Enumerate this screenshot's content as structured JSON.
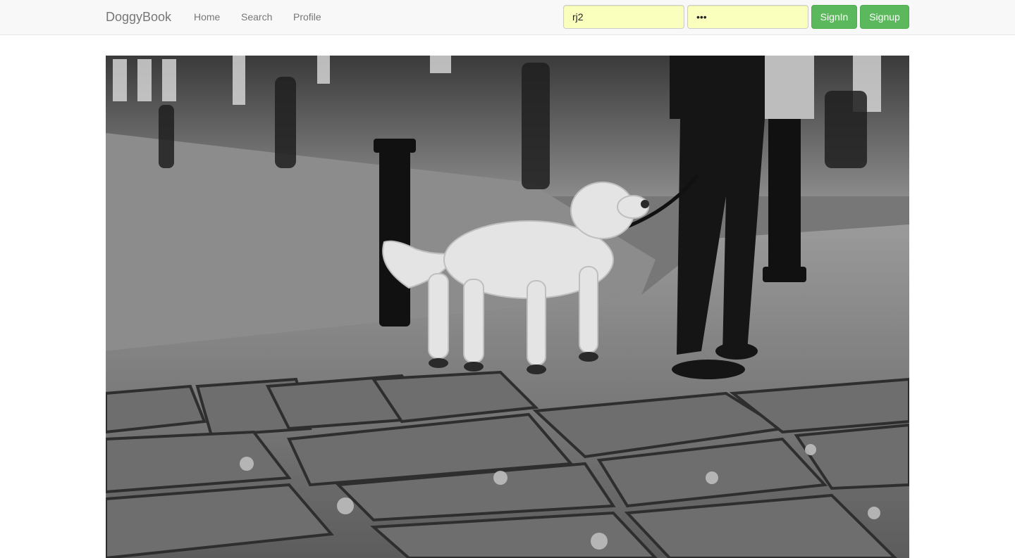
{
  "navbar": {
    "brand": "DoggyBook",
    "links": [
      {
        "label": "Home"
      },
      {
        "label": "Search"
      },
      {
        "label": "Profile"
      }
    ]
  },
  "login": {
    "username_value": "rj2",
    "password_value": "•••",
    "signin_label": "SignIn",
    "signup_label": "Signup",
    "field_color": "#faffbd",
    "button_color": "#5cb85c"
  },
  "photo": {
    "style": "black-and-white street photo",
    "subject": "dog-on-leash-icon"
  }
}
